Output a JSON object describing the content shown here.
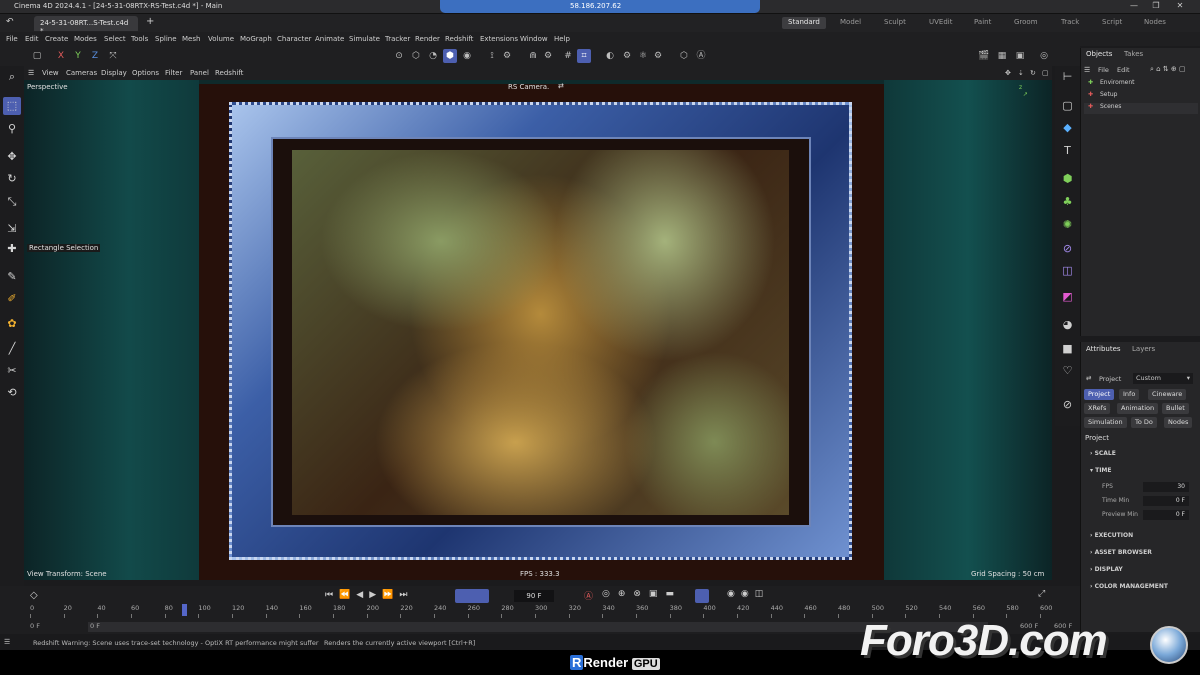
{
  "window": {
    "title": "Cinema 4D 2024.4.1 - [24-5-31-08RTX-RS-Test.c4d *] - Main",
    "remote_ip": "58.186.207.62",
    "doc_tab": "24-5-31-08RT...S-Test.c4d *"
  },
  "layouts": [
    "Standard",
    "Model",
    "Sculpt",
    "UVEdit",
    "Paint",
    "Groom",
    "Track",
    "Script",
    "Nodes"
  ],
  "menu": [
    "File",
    "Edit",
    "Create",
    "Modes",
    "Select",
    "Tools",
    "Spline",
    "Mesh",
    "Volume",
    "MoGraph",
    "Character",
    "Animate",
    "Simulate",
    "Tracker",
    "Render",
    "Redshift",
    "Extensions",
    "Window",
    "Help"
  ],
  "axis_buttons": [
    "X",
    "Y",
    "Z"
  ],
  "viewport": {
    "menu": [
      "View",
      "Cameras",
      "Display",
      "Options",
      "Filter",
      "Panel",
      "Redshift"
    ],
    "name": "Perspective",
    "camera": "RS Camera.",
    "tool_hint": "Rectangle Selection",
    "view_transform": "View Transform: Scene",
    "fps": "FPS : 333.3",
    "grid": "Grid Spacing : 50 cm"
  },
  "objects_panel": {
    "tabs": [
      "Objects",
      "Takes"
    ],
    "menu": [
      "File",
      "Edit"
    ],
    "items": [
      "Enviroment",
      "Setup",
      "Scenes"
    ]
  },
  "attributes": {
    "tabs": [
      "Attributes",
      "Layers"
    ],
    "mode_label": "Project",
    "mode_value": "Custom",
    "buttons_row1": [
      "Project",
      "Info",
      "Cineware"
    ],
    "buttons_row2": [
      "XRefs",
      "Animation",
      "Bullet"
    ],
    "buttons_row3": [
      "Simulation",
      "To Do",
      "Nodes"
    ],
    "section_title": "Project",
    "sections": [
      "SCALE",
      "TIME",
      "EXECUTION",
      "ASSET BROWSER",
      "DISPLAY",
      "COLOR MANAGEMENT"
    ],
    "fields": [
      {
        "label": "FPS",
        "value": "30"
      },
      {
        "label": "Time Min",
        "value": "0 F"
      },
      {
        "label": "Preview Min",
        "value": "0 F"
      }
    ]
  },
  "timeline": {
    "current_frame": "90 F",
    "ticks": [
      "0",
      "20",
      "40",
      "60",
      "80",
      "100",
      "120",
      "140",
      "160",
      "180",
      "200",
      "220",
      "240",
      "260",
      "280",
      "300",
      "320",
      "340",
      "360",
      "380",
      "400",
      "420",
      "440",
      "460",
      "480",
      "500",
      "520",
      "540",
      "560",
      "580",
      "600"
    ],
    "start": "0 F",
    "start2": "0 F",
    "end": "600 F",
    "end2": "600 F"
  },
  "status": {
    "warning": "Redshift Warning: Scene uses trace-set technology - OptiX RT performance might suffer",
    "hint": "Renders the currently active viewport [Ctrl+R]"
  },
  "watermark": {
    "left": "Render",
    "right": "GPU",
    "brand": "Foro3D.com"
  }
}
